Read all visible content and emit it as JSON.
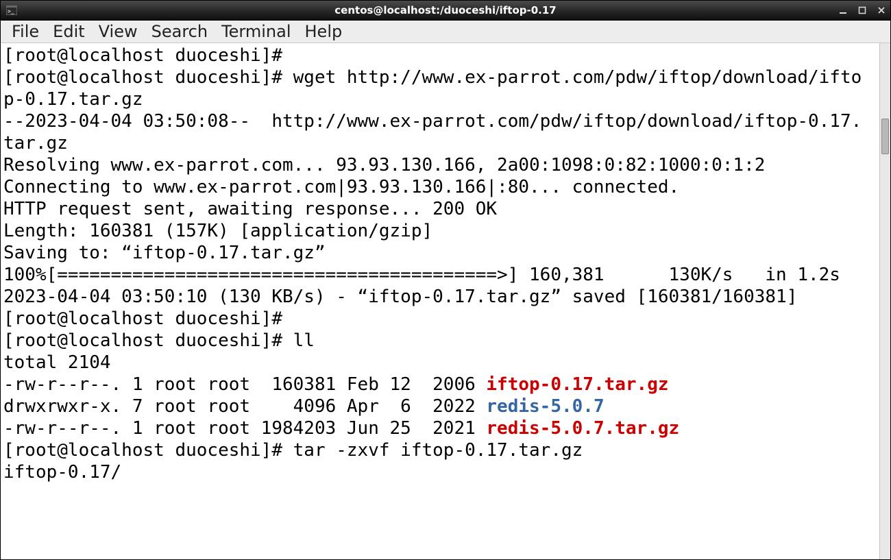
{
  "titlebar": {
    "title": "centos@localhost:/duoceshi/iftop-0.17"
  },
  "menubar": {
    "items": [
      "File",
      "Edit",
      "View",
      "Search",
      "Terminal",
      "Help"
    ]
  },
  "colors": {
    "red": "#cc0000",
    "blue": "#3465a4"
  },
  "terminal": {
    "lines": [
      {
        "segs": [
          {
            "t": "[root@localhost duoceshi]#"
          }
        ]
      },
      {
        "segs": [
          {
            "t": "[root@localhost duoceshi]# wget http://www.ex-parrot.com/pdw/iftop/download/ifto"
          }
        ]
      },
      {
        "segs": [
          {
            "t": "p-0.17.tar.gz"
          }
        ]
      },
      {
        "segs": [
          {
            "t": "--2023-04-04 03:50:08--  http://www.ex-parrot.com/pdw/iftop/download/iftop-0.17."
          }
        ]
      },
      {
        "segs": [
          {
            "t": "tar.gz"
          }
        ]
      },
      {
        "segs": [
          {
            "t": "Resolving www.ex-parrot.com... 93.93.130.166, 2a00:1098:0:82:1000:0:1:2"
          }
        ]
      },
      {
        "segs": [
          {
            "t": "Connecting to www.ex-parrot.com|93.93.130.166|:80... connected."
          }
        ]
      },
      {
        "segs": [
          {
            "t": "HTTP request sent, awaiting response... 200 OK"
          }
        ]
      },
      {
        "segs": [
          {
            "t": "Length: 160381 (157K) [application/gzip]"
          }
        ]
      },
      {
        "segs": [
          {
            "t": "Saving to: “iftop-0.17.tar.gz”"
          }
        ]
      },
      {
        "segs": [
          {
            "t": ""
          }
        ]
      },
      {
        "segs": [
          {
            "t": "100%[=========================================>] 160,381      130K/s   in 1.2s"
          }
        ]
      },
      {
        "segs": [
          {
            "t": ""
          }
        ]
      },
      {
        "segs": [
          {
            "t": "2023-04-04 03:50:10 (130 KB/s) - “iftop-0.17.tar.gz” saved [160381/160381]"
          }
        ]
      },
      {
        "segs": [
          {
            "t": ""
          }
        ]
      },
      {
        "segs": [
          {
            "t": "[root@localhost duoceshi]#"
          }
        ]
      },
      {
        "segs": [
          {
            "t": "[root@localhost duoceshi]# ll"
          }
        ]
      },
      {
        "segs": [
          {
            "t": "total 2104"
          }
        ]
      },
      {
        "segs": [
          {
            "t": "-rw-r--r--. 1 root root  160381 Feb 12  2006 "
          },
          {
            "t": "iftop-0.17.tar.gz",
            "c": "red"
          }
        ]
      },
      {
        "segs": [
          {
            "t": "drwxrwxr-x. 7 root root    4096 Apr  6  2022 "
          },
          {
            "t": "redis-5.0.7",
            "c": "blue"
          }
        ]
      },
      {
        "segs": [
          {
            "t": "-rw-r--r--. 1 root root 1984203 Jun 25  2021 "
          },
          {
            "t": "redis-5.0.7.tar.gz",
            "c": "red"
          }
        ]
      },
      {
        "segs": [
          {
            "t": "[root@localhost duoceshi]# tar -zxvf iftop-0.17.tar.gz"
          }
        ]
      },
      {
        "segs": [
          {
            "t": "iftop-0.17/"
          }
        ]
      }
    ]
  }
}
